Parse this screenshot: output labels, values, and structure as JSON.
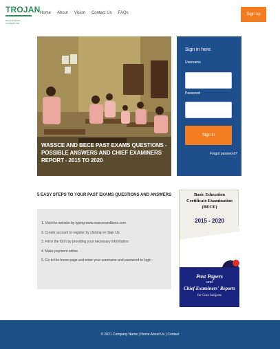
{
  "header": {
    "logo_text": "TROJAN",
    "logo_sub": "EDUCATIONAL CONSULTING",
    "nav": [
      "Home",
      "About",
      "Vision",
      "Contact Us",
      "FAQs"
    ],
    "signup_label": "Sign up"
  },
  "hero": {
    "caption": "WASSCE AND BECE PAST EXAMS QUESTIONS - POSSIBLE ANSWERS AND CHIEF EXAMINERS REPORT - 2015 TO 2020"
  },
  "signin": {
    "title": "Sign in here",
    "username_label": "Username",
    "password_label": "Password",
    "button_label": "Sign in",
    "forgot_label": "Forgot password?"
  },
  "steps": {
    "title": "5 EASY STEPS TO YOUR PAST EXAMS QUESTIONS AND ANSWERS",
    "items": [
      "1. Visit the website by typing www.wassceandbece.com",
      "2. Create account to register by clicking on Sign Up",
      "3. Fill in the form by providing your necessary information",
      "4. Make payment online",
      "5. Go to the home page and enter your username and password to login"
    ]
  },
  "book": {
    "line1": "Basic Education",
    "line2": "Certificate Examination",
    "line3": "(BECE)",
    "years": "2015 - 2020",
    "past_papers": "Past Papers",
    "and": "and",
    "chief": "Chief Examiners' Reports",
    "core": "for Core Subjects"
  },
  "footer": {
    "text": "© 2021 Company Name  |  Home  About Us  |  Contact"
  },
  "colors": {
    "accent": "#f47c20",
    "navy": "#1f4e8c",
    "logo_green": "#2e8b57"
  }
}
